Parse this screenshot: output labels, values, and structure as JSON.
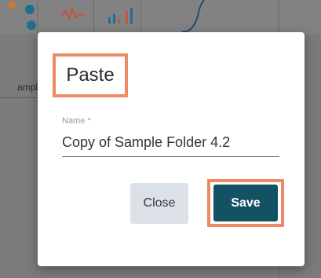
{
  "background": {
    "partial_label": "ampl"
  },
  "dialog": {
    "title": "Paste",
    "name_label": "Name *",
    "name_value": "Copy of Sample Folder 4.2",
    "close_label": "Close",
    "save_label": "Save"
  },
  "colors": {
    "highlight": "#ee8a66",
    "save_button": "#135262",
    "close_button": "#dbe1e7"
  }
}
